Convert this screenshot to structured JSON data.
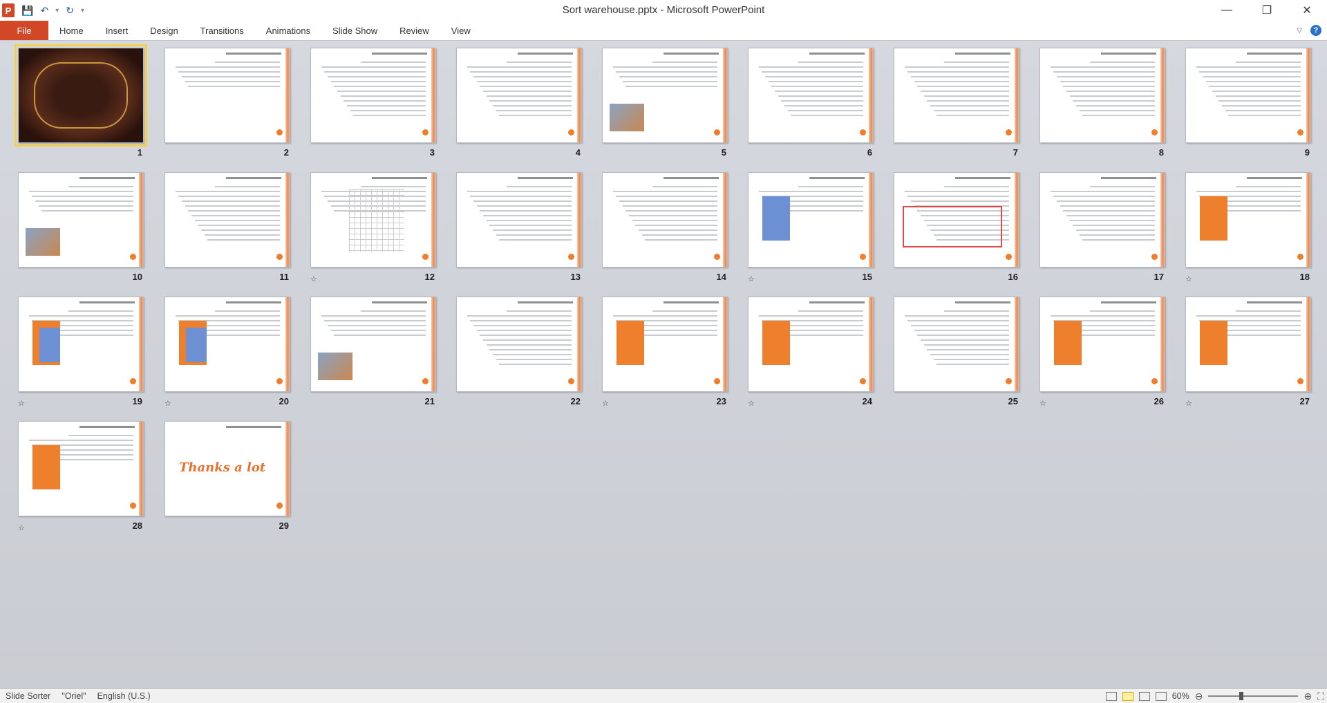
{
  "window": {
    "title": "Sort warehouse.pptx - Microsoft PowerPoint",
    "app_letter": "P"
  },
  "quick_access": {
    "save_icon": "save-icon",
    "undo_icon": "undo-icon",
    "redo_icon": "redo-icon"
  },
  "ribbon": {
    "file_label": "File",
    "tabs": [
      "Home",
      "Insert",
      "Design",
      "Transitions",
      "Animations",
      "Slide Show",
      "Review",
      "View"
    ],
    "help_label": "?"
  },
  "slides": [
    {
      "num": "1",
      "star": false,
      "kind": "ornate",
      "selected": true
    },
    {
      "num": "2",
      "star": false,
      "kind": "title"
    },
    {
      "num": "3",
      "star": false,
      "kind": "text"
    },
    {
      "num": "4",
      "star": false,
      "kind": "text"
    },
    {
      "num": "5",
      "star": false,
      "kind": "text-pic"
    },
    {
      "num": "6",
      "star": false,
      "kind": "text"
    },
    {
      "num": "7",
      "star": false,
      "kind": "text"
    },
    {
      "num": "8",
      "star": false,
      "kind": "text"
    },
    {
      "num": "9",
      "star": false,
      "kind": "text"
    },
    {
      "num": "10",
      "star": false,
      "kind": "text-pic"
    },
    {
      "num": "11",
      "star": false,
      "kind": "text"
    },
    {
      "num": "12",
      "star": true,
      "kind": "grid"
    },
    {
      "num": "13",
      "star": false,
      "kind": "text"
    },
    {
      "num": "14",
      "star": false,
      "kind": "text"
    },
    {
      "num": "15",
      "star": true,
      "kind": "triangle"
    },
    {
      "num": "16",
      "star": false,
      "kind": "boxed"
    },
    {
      "num": "17",
      "star": false,
      "kind": "text"
    },
    {
      "num": "18",
      "star": true,
      "kind": "orange-shape"
    },
    {
      "num": "19",
      "star": true,
      "kind": "blue-orange"
    },
    {
      "num": "20",
      "star": true,
      "kind": "blue-orange"
    },
    {
      "num": "21",
      "star": false,
      "kind": "text-pic"
    },
    {
      "num": "22",
      "star": false,
      "kind": "text"
    },
    {
      "num": "23",
      "star": true,
      "kind": "orange-shape"
    },
    {
      "num": "24",
      "star": true,
      "kind": "orange-shape"
    },
    {
      "num": "25",
      "star": false,
      "kind": "text"
    },
    {
      "num": "26",
      "star": true,
      "kind": "orange-shape"
    },
    {
      "num": "27",
      "star": true,
      "kind": "orange-shape"
    },
    {
      "num": "28",
      "star": true,
      "kind": "orange-shape"
    },
    {
      "num": "29",
      "star": false,
      "kind": "thanks",
      "text": "Thanks a lot"
    }
  ],
  "status": {
    "view": "Slide Sorter",
    "theme": "\"Oriel\"",
    "language": "English (U.S.)",
    "zoom": "60%"
  }
}
